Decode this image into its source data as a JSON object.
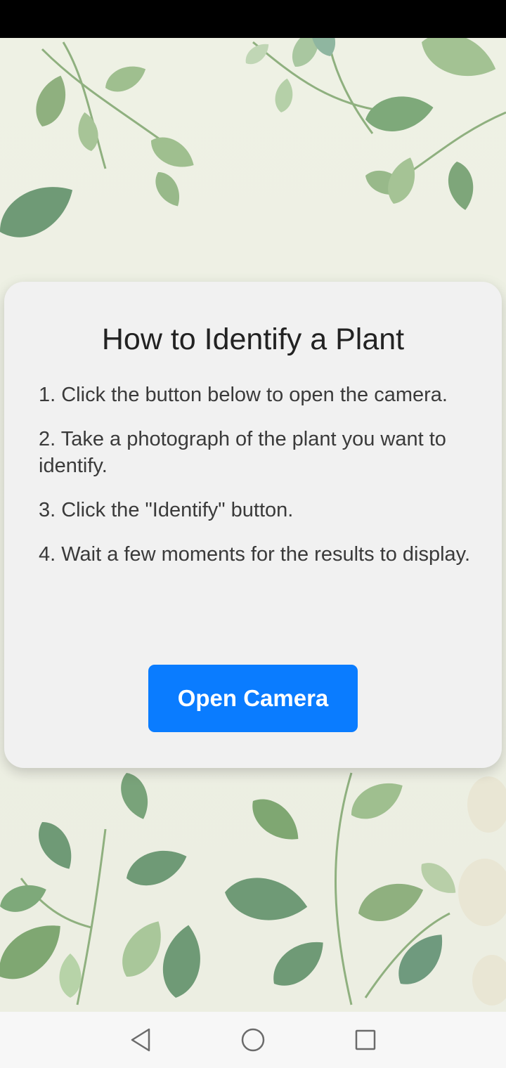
{
  "card": {
    "title": "How to Identify a Plant",
    "steps": [
      "1. Click the button below to open the camera.",
      "2. Take a photograph of the plant you want to identify.",
      "3. Click the \"Identify\" button.",
      "4. Wait a few moments for the results to display."
    ],
    "button_label": "Open Camera"
  },
  "icons": {
    "back": "back-triangle-icon",
    "home": "home-circle-icon",
    "recents": "recents-square-icon"
  },
  "colors": {
    "accent": "#0a7cff",
    "card": "#f1f1f1",
    "leaf_dark": "#6f9a76",
    "leaf_light": "#a9c79a"
  }
}
